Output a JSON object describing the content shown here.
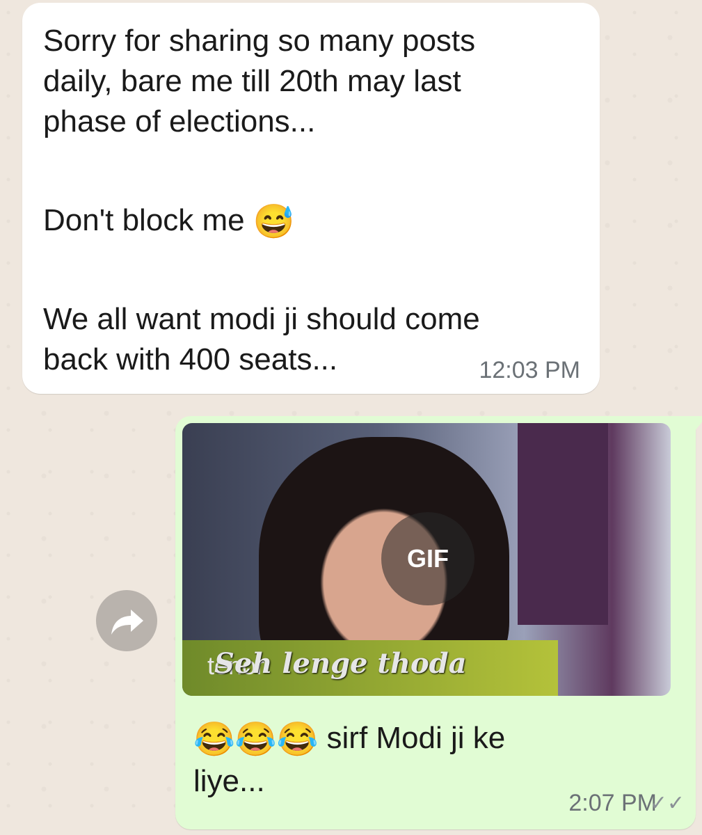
{
  "incoming_message": {
    "lines": [
      "Sorry for sharing so many posts",
      "daily, bare me till 20th may last",
      "phase of elections..."
    ],
    "line2": "Don't block me",
    "line2_emoji": "😅",
    "line3a": "We all want modi ji should come",
    "line3b": "back with 400 seats...",
    "time": "12:03 PM"
  },
  "outgoing_message": {
    "gif": {
      "badge": "GIF",
      "watermark": "tenor",
      "caption": "Seh lenge thoda"
    },
    "emojis": "😂😂😂",
    "text_a": "sirf  Modi ji ke",
    "text_b": "liye...",
    "time": "2:07 PM",
    "status": "✓✓"
  },
  "forward_button": {
    "icon": "forward-arrow-icon"
  }
}
